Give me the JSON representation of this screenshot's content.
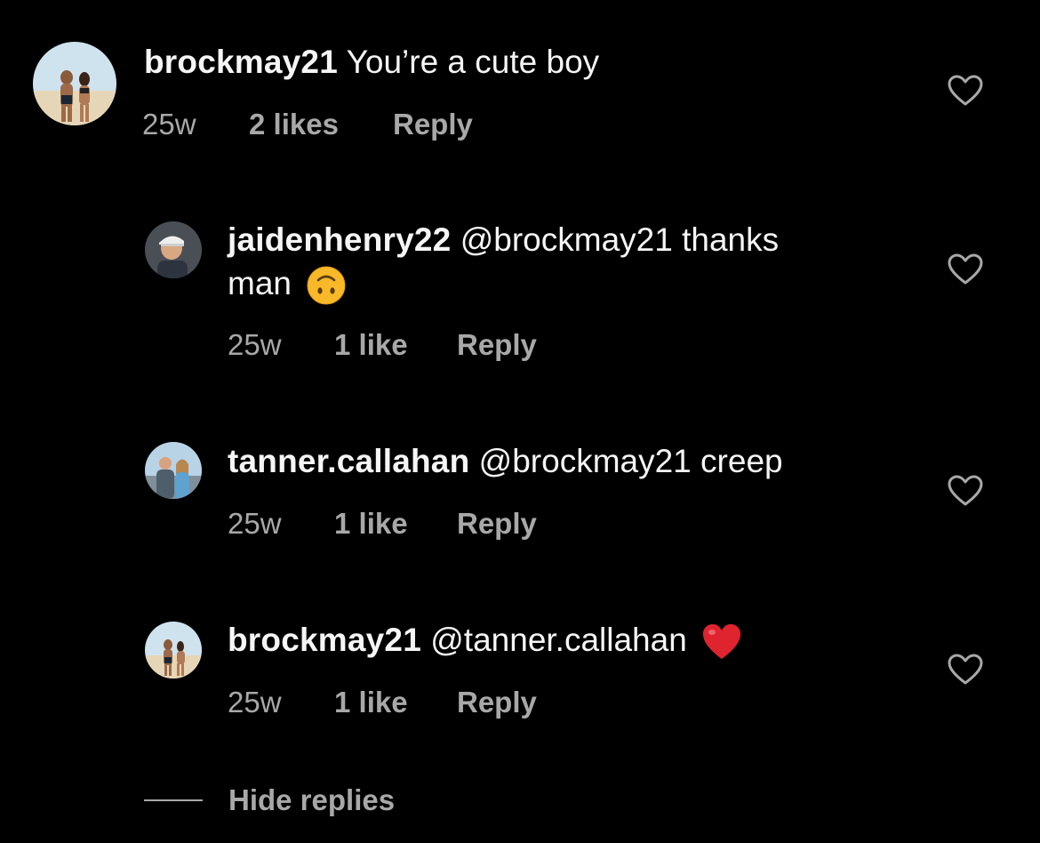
{
  "comments": [
    {
      "username": "brockmay21",
      "text": "You’re a cute boy",
      "time": "25w",
      "likes": "2 likes",
      "reply": "Reply",
      "avatar_icon": "beach-couple-photo"
    },
    {
      "username": "jaidenhenry22",
      "text_line1": "@brockmay21 thanks",
      "text_line2": "man",
      "emoji": "upside-down-face",
      "time": "25w",
      "likes": "1 like",
      "reply": "Reply",
      "avatar_icon": "man-with-cap-photo"
    },
    {
      "username": "tanner.callahan",
      "text": "@brockmay21 creep",
      "time": "25w",
      "likes": "1 like",
      "reply": "Reply",
      "avatar_icon": "couple-outdoors-photo"
    },
    {
      "username": "brockmay21",
      "text": "@tanner.callahan",
      "emoji": "red-heart",
      "time": "25w",
      "likes": "1 like",
      "reply": "Reply",
      "avatar_icon": "beach-couple-photo"
    }
  ],
  "hide_replies": "Hide replies",
  "colors": {
    "background": "#000000",
    "primary_text": "#f5f5f5",
    "secondary_text": "#a8a8a8",
    "heart_emoji": "#e0242f",
    "face_emoji": "#f7b928"
  }
}
